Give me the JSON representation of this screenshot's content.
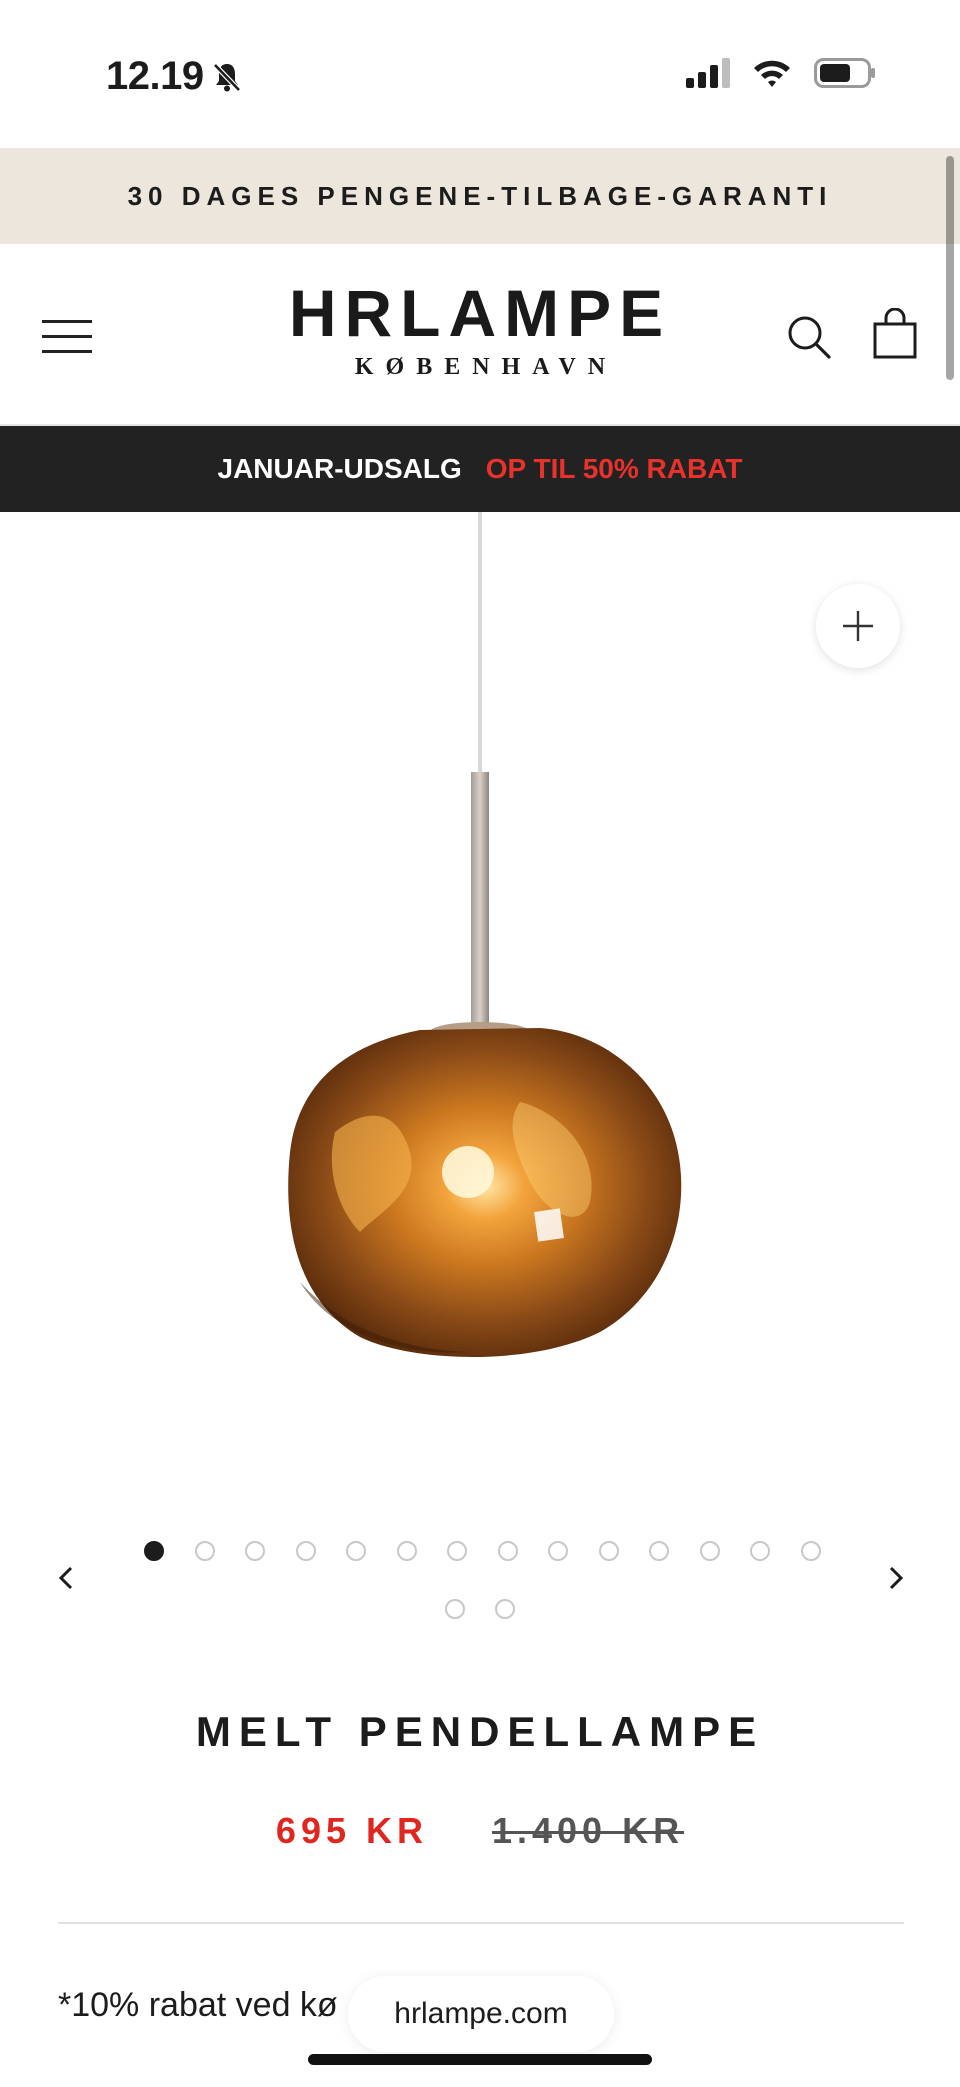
{
  "status_bar": {
    "time": "12.19",
    "icons": [
      "bell-muted-icon",
      "signal-icon",
      "wifi-icon",
      "battery-icon"
    ]
  },
  "announcement": {
    "text": "30 DAGES PENGENE-TILBAGE-GARANTI"
  },
  "header": {
    "logo_main": "HRLAMPE",
    "logo_sub": "KØBENHAVN",
    "icons": [
      "menu-icon",
      "search-icon",
      "cart-icon"
    ]
  },
  "promo": {
    "label": "JANUAR-UDSALG",
    "offer": "OP TIL 50% RABAT",
    "offer_color": "#e8322b"
  },
  "gallery": {
    "image_alt": "Melt pendellampe copper",
    "total_images": 16,
    "active_index": 0,
    "icons": [
      "zoom-plus-icon",
      "chevron-left-icon",
      "chevron-right-icon"
    ]
  },
  "product": {
    "title": "MELT PENDELLAMPE",
    "price_sale": "695 KR",
    "price_original": "1.400 KR",
    "sale_color": "#e0271f",
    "discount_note": "*10% rabat ved kø"
  },
  "browser": {
    "url": "hrlampe.com"
  },
  "colors": {
    "announcement_bg": "#ece6dc",
    "promo_bg": "#222222",
    "text": "#1c1c1c"
  }
}
